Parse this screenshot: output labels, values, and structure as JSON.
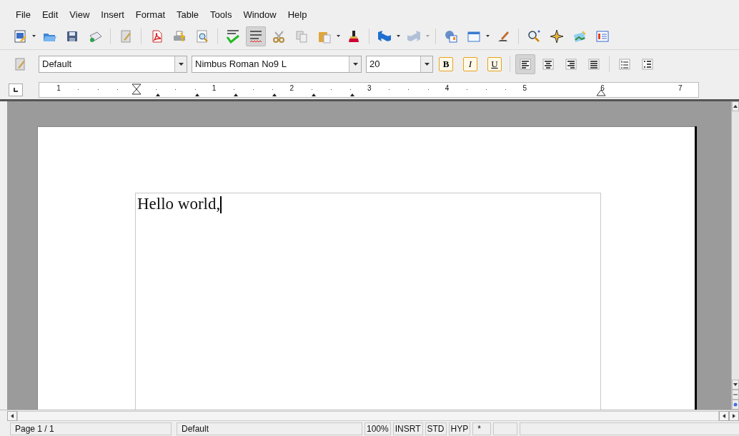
{
  "menu": [
    "File",
    "Edit",
    "View",
    "Insert",
    "Format",
    "Table",
    "Tools",
    "Window",
    "Help"
  ],
  "toolbar": [
    {
      "kind": "new",
      "dropdown": true,
      "selected": false,
      "disabled": false
    },
    {
      "kind": "open",
      "dropdown": false,
      "selected": false,
      "disabled": false
    },
    {
      "kind": "save",
      "dropdown": false,
      "selected": false,
      "disabled": false
    },
    {
      "kind": "mail",
      "dropdown": false,
      "selected": false,
      "disabled": false
    },
    {
      "kind": "edit",
      "dropdown": false,
      "selected": false,
      "disabled": false
    },
    {
      "kind": "pdf",
      "dropdown": false,
      "selected": false,
      "disabled": false
    },
    {
      "kind": "print",
      "dropdown": false,
      "selected": false,
      "disabled": false
    },
    {
      "kind": "preview",
      "dropdown": false,
      "selected": false,
      "disabled": false
    },
    {
      "kind": "spell",
      "dropdown": false,
      "selected": false,
      "disabled": false
    },
    {
      "kind": "autospell",
      "dropdown": false,
      "selected": true,
      "disabled": false
    },
    {
      "kind": "cut",
      "dropdown": false,
      "selected": false,
      "disabled": false
    },
    {
      "kind": "copy",
      "dropdown": false,
      "selected": false,
      "disabled": false
    },
    {
      "kind": "paste",
      "dropdown": true,
      "selected": false,
      "disabled": false
    },
    {
      "kind": "brush",
      "dropdown": false,
      "selected": false,
      "disabled": false
    },
    {
      "kind": "undo",
      "dropdown": true,
      "selected": false,
      "disabled": false
    },
    {
      "kind": "redo",
      "dropdown": true,
      "selected": false,
      "disabled": true
    },
    {
      "kind": "globe",
      "dropdown": false,
      "selected": false,
      "disabled": false
    },
    {
      "kind": "table",
      "dropdown": true,
      "selected": false,
      "disabled": false
    },
    {
      "kind": "draw",
      "dropdown": false,
      "selected": false,
      "disabled": false
    },
    {
      "kind": "find",
      "dropdown": false,
      "selected": false,
      "disabled": false
    },
    {
      "kind": "star",
      "dropdown": false,
      "selected": false,
      "disabled": false
    },
    {
      "kind": "gallery",
      "dropdown": false,
      "selected": false,
      "disabled": false
    },
    {
      "kind": "list",
      "dropdown": false,
      "selected": false,
      "disabled": false
    }
  ],
  "format_bar": {
    "paragraph_style": "Default",
    "font_name": "Nimbus Roman No9 L",
    "font_size": "20",
    "styles": [
      {
        "label": "B",
        "kind": "bold",
        "selected": false
      },
      {
        "label": "I",
        "kind": "italic",
        "selected": false
      },
      {
        "label": "U",
        "kind": "underline",
        "selected": false
      }
    ],
    "alignment": [
      {
        "kind": "left",
        "selected": true
      },
      {
        "kind": "center",
        "selected": false
      },
      {
        "kind": "right",
        "selected": false
      },
      {
        "kind": "justify",
        "selected": false
      }
    ],
    "lists": [
      {
        "kind": "numbered"
      },
      {
        "kind": "bullets"
      }
    ]
  },
  "ruler": {
    "labels": [
      "1",
      "1",
      "2",
      "3",
      "4",
      "5",
      "6",
      "7"
    ]
  },
  "document": {
    "text": "Hello world,"
  },
  "status_bar": [
    "Page 1 / 1",
    "Default",
    "100%",
    "INSRT",
    "STD",
    "HYP",
    "*"
  ]
}
